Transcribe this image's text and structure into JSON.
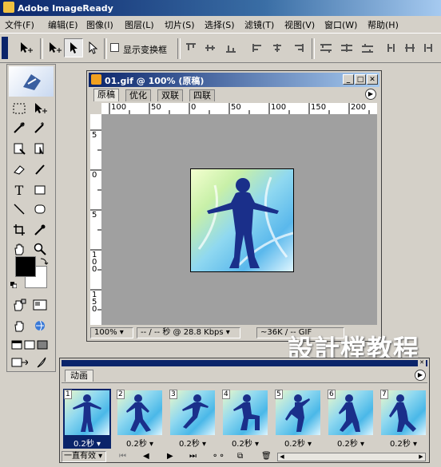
{
  "app": {
    "title": "Adobe ImageReady"
  },
  "menu": [
    "文件(F)",
    "编辑(E)",
    "图像(I)",
    "图层(L)",
    "切片(S)",
    "选择(S)",
    "滤镜(T)",
    "视图(V)",
    "窗口(W)",
    "帮助(H)"
  ],
  "options": {
    "show_transform_label": "显示变换框",
    "show_transform_checked": false
  },
  "document": {
    "title": "01.gif @ 100% (原稿)",
    "tabs": [
      "原稿",
      "优化",
      "双联",
      "四联"
    ],
    "active_tab": 0,
    "ruler_h_labels": [
      "100",
      "50",
      "0",
      "50",
      "100",
      "150",
      "200"
    ],
    "ruler_v_labels": [
      "5",
      "0",
      "5",
      "1 0 0",
      "1 5 0"
    ],
    "zoom": "100%",
    "download_info": "-- / -- 秒 @ 28.8 Kbps",
    "size_info": "~36K / -- GIF"
  },
  "animation_panel": {
    "tab": "动画",
    "loop": "一直有效",
    "frames": [
      {
        "num": "1",
        "delay": "0.2秒",
        "selected": true
      },
      {
        "num": "2",
        "delay": "0.2秒",
        "selected": false
      },
      {
        "num": "3",
        "delay": "0.2秒",
        "selected": false
      },
      {
        "num": "4",
        "delay": "0.2秒",
        "selected": false
      },
      {
        "num": "5",
        "delay": "0.2秒",
        "selected": false
      },
      {
        "num": "6",
        "delay": "0.2秒",
        "selected": false
      },
      {
        "num": "7",
        "delay": "0.2秒",
        "selected": false
      }
    ]
  },
  "watermark": "設計樘教程",
  "colors": {
    "titlebar": "#0a246a",
    "foreground_color": "#000000",
    "background_color": "#ffffff"
  }
}
